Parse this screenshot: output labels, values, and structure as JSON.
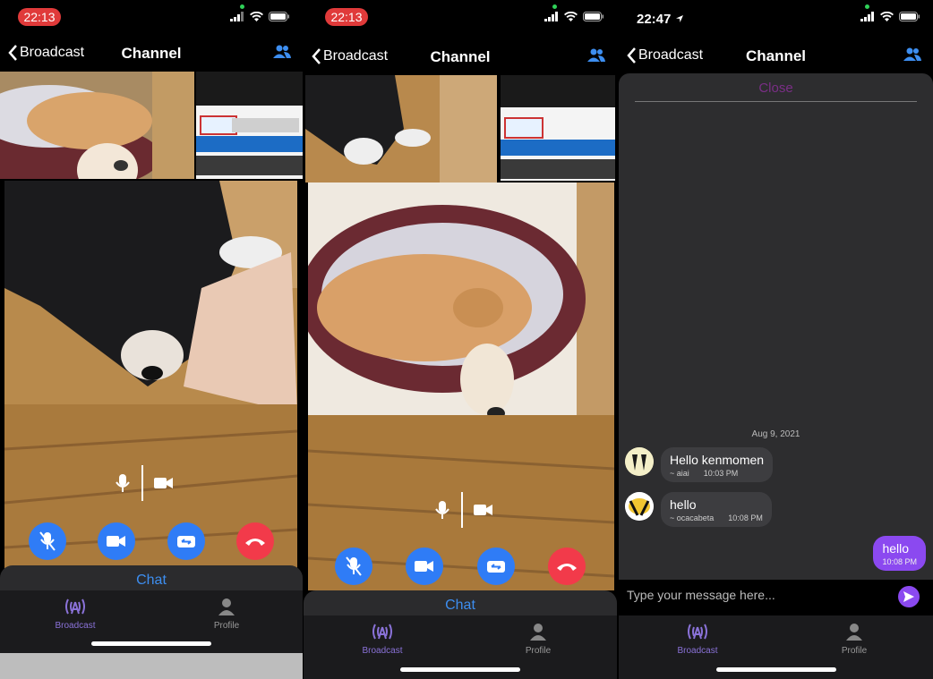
{
  "phone1": {
    "status_time": "22:13",
    "nav": {
      "back_label": "Broadcast",
      "title": "Channel"
    },
    "chat_label": "Chat",
    "tabs": [
      {
        "label": "Broadcast",
        "icon": "broadcast-icon"
      },
      {
        "label": "Profile",
        "icon": "profile-icon"
      }
    ]
  },
  "phone2": {
    "status_time": "22:13",
    "nav": {
      "back_label": "Broadcast",
      "title": "Channel"
    },
    "chat_label": "Chat",
    "tabs": [
      {
        "label": "Broadcast",
        "icon": "broadcast-icon"
      },
      {
        "label": "Profile",
        "icon": "profile-icon"
      }
    ]
  },
  "phone3": {
    "status_time": "22:47",
    "nav": {
      "back_label": "Broadcast",
      "title": "Channel"
    },
    "chat": {
      "close_label": "Close",
      "date": "Aug 9, 2021",
      "messages": [
        {
          "text": "Hello kenmomen",
          "sender": "~ aiai",
          "time": "10:03 PM"
        },
        {
          "text": "hello",
          "sender": "~ ocacabeta",
          "time": "10:08 PM"
        },
        {
          "text": "hello",
          "time": "10:08 PM"
        }
      ],
      "input_placeholder": "Type your message here..."
    },
    "tabs": [
      {
        "label": "Broadcast",
        "icon": "broadcast-icon"
      },
      {
        "label": "Profile",
        "icon": "profile-icon"
      }
    ]
  },
  "colors": {
    "accent_blue": "#2f7cf6",
    "end_red": "#f23a4a",
    "chat_label": "#3d8ef0",
    "tab_active": "#8a72d8",
    "own_bubble": "#8b49f0"
  }
}
